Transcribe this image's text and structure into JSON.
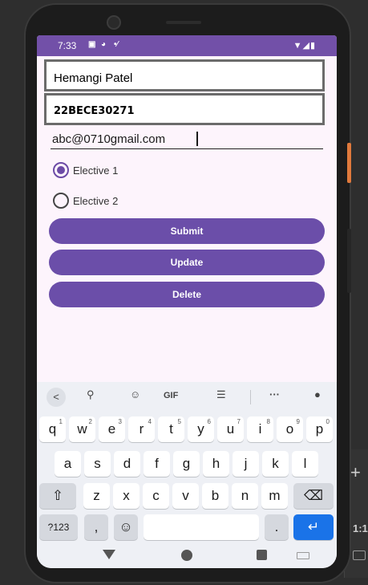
{
  "status_bar": {
    "time": "7:33",
    "left_icons": [
      "photo-icon",
      "play-icon",
      "signal-extra-icon"
    ],
    "right_icons": [
      "wifi-icon",
      "cell-signal-icon",
      "battery-icon"
    ]
  },
  "form": {
    "name_value": "Hemangi Patel",
    "id_value": "22BECE30271",
    "email_value": "abc@0710gmail.com",
    "radios": [
      {
        "label": "Elective 1",
        "checked": true
      },
      {
        "label": "Elective 2",
        "checked": false
      }
    ],
    "buttons": {
      "submit": "Submit",
      "update": "Update",
      "delete": "Delete"
    }
  },
  "keyboard": {
    "toolbar": {
      "gif": "GIF",
      "more": "···"
    },
    "row1": [
      {
        "key": "q",
        "alt": "1"
      },
      {
        "key": "w",
        "alt": "2"
      },
      {
        "key": "e",
        "alt": "3"
      },
      {
        "key": "r",
        "alt": "4"
      },
      {
        "key": "t",
        "alt": "5"
      },
      {
        "key": "y",
        "alt": "6"
      },
      {
        "key": "u",
        "alt": "7"
      },
      {
        "key": "i",
        "alt": "8"
      },
      {
        "key": "o",
        "alt": "9"
      },
      {
        "key": "p",
        "alt": "0"
      }
    ],
    "row2": [
      "a",
      "s",
      "d",
      "f",
      "g",
      "h",
      "j",
      "k",
      "l"
    ],
    "row3": [
      "z",
      "x",
      "c",
      "v",
      "b",
      "n",
      "m"
    ],
    "symbols": "?123",
    "comma": ",",
    "period": "."
  },
  "colors": {
    "accent": "#6b4ea9",
    "status_bar": "#7250a8",
    "screen_bg": "#fdf4fc",
    "enter_key": "#1a73e8"
  }
}
